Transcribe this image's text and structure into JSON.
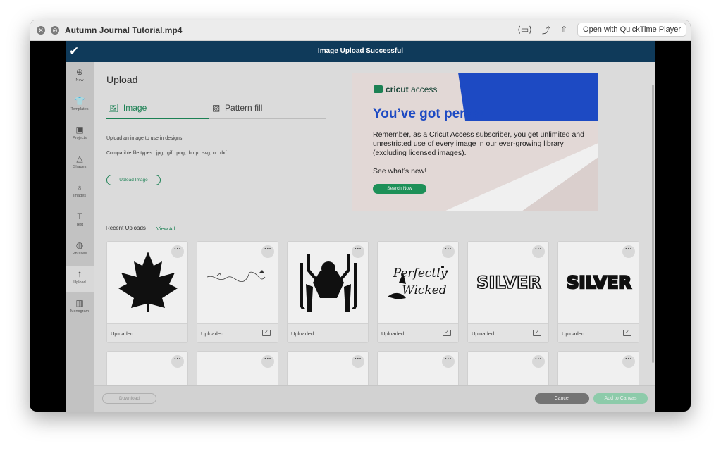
{
  "window": {
    "title": "Autumn Journal Tutorial.mp4",
    "open_with_label": "Open with QuickTime Player"
  },
  "banner": {
    "text": "Image Upload Successful"
  },
  "sidebar": {
    "items": [
      {
        "label": "New",
        "icon": "plus-icon"
      },
      {
        "label": "Templates",
        "icon": "shirt-icon"
      },
      {
        "label": "Projects",
        "icon": "projects-icon"
      },
      {
        "label": "Shapes",
        "icon": "shapes-icon"
      },
      {
        "label": "Images",
        "icon": "bulb-icon"
      },
      {
        "label": "Text",
        "icon": "text-icon"
      },
      {
        "label": "Phrases",
        "icon": "chat-icon"
      },
      {
        "label": "Upload",
        "icon": "upload-icon"
      },
      {
        "label": "Monogram",
        "icon": "monogram-icon"
      }
    ]
  },
  "upload": {
    "title": "Upload",
    "tab_image": "Image",
    "tab_pattern": "Pattern fill",
    "desc1": "Upload an image to use in designs.",
    "desc2": "Compatible file types: .jpg, .gif, .png, .bmp, .svg, or .dxf",
    "upload_button": "Upload Image"
  },
  "promo": {
    "logo_bold": "cricut",
    "logo_light": "access",
    "headline": "You’ve got perks!",
    "body": "Remember, as a Cricut Access subscriber, you get unlimited and unrestricted use of every image in our ever-growing library (excluding licensed images).",
    "see_new": "See what’s new!",
    "button": "Search Now"
  },
  "recent": {
    "label": "Recent Uploads",
    "view_all": "View All",
    "cards": [
      {
        "label": "Uploaded",
        "image": "maple-leaf"
      },
      {
        "label": "Uploaded",
        "image": "sketch-line"
      },
      {
        "label": "Uploaded",
        "image": "spider-logo"
      },
      {
        "label": "Uploaded",
        "image": "perfectly-wicked",
        "art_text_1": "Perfectly",
        "art_text_2": "Wicked"
      },
      {
        "label": "Uploaded",
        "image": "silver-outline",
        "art_text": "SILVER"
      },
      {
        "label": "Uploaded",
        "image": "silver-solid",
        "art_text": "SILVER"
      }
    ]
  },
  "footer": {
    "download": "Download",
    "cancel": "Cancel",
    "add_to_canvas": "Add to Canvas"
  }
}
